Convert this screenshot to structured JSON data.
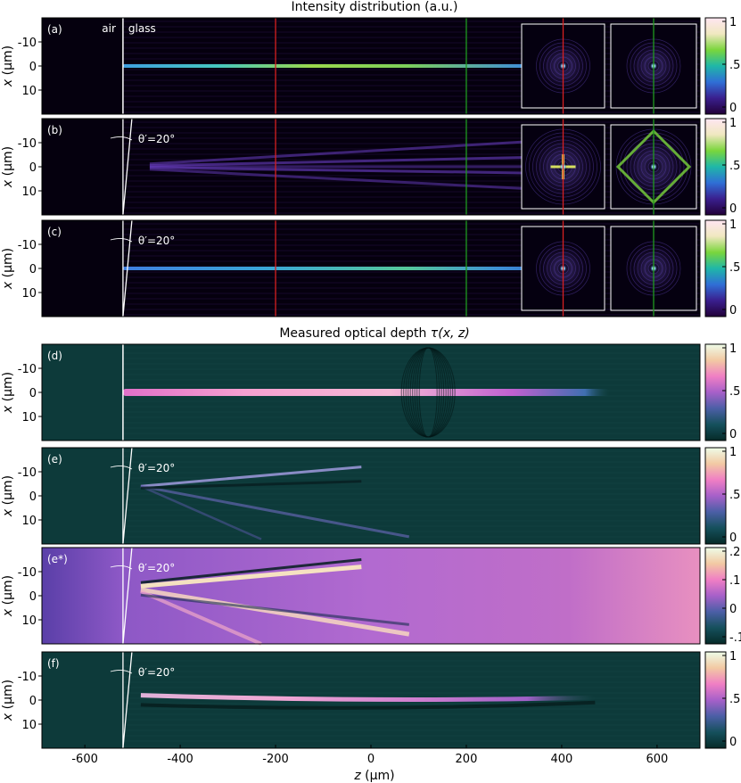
{
  "figure": {
    "title_top": "Intensity distribution (a.u.)",
    "title_bottom_prefix": "Measured optical depth ",
    "title_bottom_math": "τ(x, z)",
    "air_label": "air",
    "glass_label": "glass",
    "angle_label": "θ′=20°",
    "xlabel_var": "z",
    "xlabel_unit": " (μm)",
    "ylabel_var": "x",
    "ylabel_unit": " (μm)"
  },
  "chart_data": {
    "type": "heatmap",
    "xlabel": "z (μm)",
    "ylabel": "x (μm)",
    "x_range": [
      -690,
      690
    ],
    "y_range": [
      -20,
      20
    ],
    "x_ticks": [
      -600,
      -400,
      -200,
      0,
      200,
      400,
      600
    ],
    "x_tick_labels": [
      "-600",
      "-400",
      "-200",
      "0",
      "200",
      "400",
      "600"
    ],
    "y_ticks": [
      -10,
      0,
      10
    ],
    "y_tick_labels": [
      "-10",
      "0",
      "10"
    ],
    "interface_z": -520,
    "marker_lines": [
      {
        "z": -200,
        "color": "#d62020"
      },
      {
        "z": 200,
        "color": "#1f9a1f"
      }
    ],
    "colormaps": {
      "intensity": [
        "#220038",
        "#3a1f8e",
        "#2f6fd6",
        "#1fb7a8",
        "#7ad63c",
        "#f0e8c0",
        "#ffe6f2"
      ],
      "depth": [
        "#062a28",
        "#15505c",
        "#4b5fa6",
        "#a760c9",
        "#f07fc4",
        "#f2c9a3",
        "#eefce8"
      ]
    },
    "panels": [
      {
        "label": "(a)",
        "group": "intensity",
        "tilt_deg": 0,
        "colorbar_ticks": [
          "1",
          ".5",
          "0"
        ],
        "colorbar_range": [
          0,
          1
        ],
        "has_insets": true
      },
      {
        "label": "(b)",
        "group": "intensity",
        "tilt_deg": 20,
        "colorbar_ticks": [
          "1",
          ".5",
          "0"
        ],
        "colorbar_range": [
          0,
          1
        ],
        "has_insets": true
      },
      {
        "label": "(c)",
        "group": "intensity",
        "tilt_deg": 20,
        "colorbar_ticks": [
          "1",
          ".5",
          "0"
        ],
        "colorbar_range": [
          0,
          1
        ],
        "has_insets": true
      },
      {
        "label": "(d)",
        "group": "depth",
        "tilt_deg": 0,
        "colorbar_ticks": [
          "1",
          ".5",
          "0"
        ],
        "colorbar_range": [
          0,
          1
        ],
        "has_insets": false
      },
      {
        "label": "(e)",
        "group": "depth",
        "tilt_deg": 20,
        "colorbar_ticks": [
          "1",
          ".5",
          "0"
        ],
        "colorbar_range": [
          0,
          1
        ],
        "has_insets": false
      },
      {
        "label": "(e*)",
        "group": "depth",
        "tilt_deg": 20,
        "colorbar_ticks": [
          ".2",
          ".1",
          "0",
          "-.1"
        ],
        "colorbar_range": [
          -0.1,
          0.2
        ],
        "has_insets": false
      },
      {
        "label": "(f)",
        "group": "depth",
        "tilt_deg": 20,
        "colorbar_ticks": [
          "1",
          ".5",
          "0"
        ],
        "colorbar_range": [
          0,
          1
        ],
        "has_insets": false
      }
    ]
  }
}
